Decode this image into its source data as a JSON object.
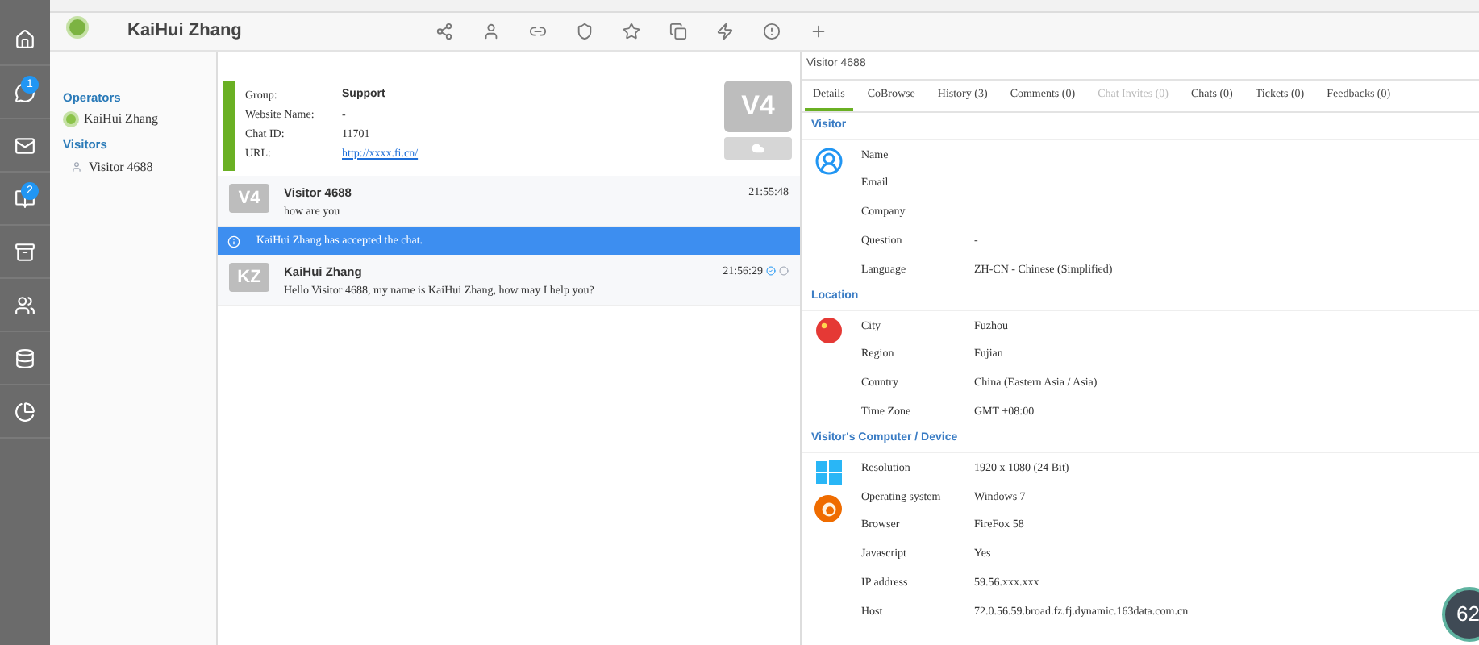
{
  "header": {
    "operator_name": "KaiHui Zhang",
    "online": true
  },
  "rail": [
    {
      "kind": "home"
    },
    {
      "kind": "chat",
      "badge": "1"
    },
    {
      "kind": "mail"
    },
    {
      "kind": "book",
      "badge": "2"
    },
    {
      "kind": "archive"
    },
    {
      "kind": "users"
    },
    {
      "kind": "database"
    },
    {
      "kind": "pie"
    }
  ],
  "sidebar": {
    "operators_title": "Operators",
    "operators": [
      {
        "name": "KaiHui Zhang",
        "online": true
      }
    ],
    "visitors_title": "Visitors",
    "visitors": [
      {
        "name": "Visitor 4688"
      }
    ]
  },
  "chat_info": {
    "rows": [
      {
        "label": "Group:",
        "value": "Support",
        "kind": "text"
      },
      {
        "label": "Website Name:",
        "value": "-",
        "kind": "text"
      },
      {
        "label": "Chat ID:",
        "value": "11701",
        "kind": "text"
      },
      {
        "label": "URL:",
        "value": "http://xxxx.fi.cn/",
        "kind": "link"
      }
    ],
    "avatar": "V4"
  },
  "messages": [
    {
      "kind": "message",
      "avatar": "V4",
      "author": "Visitor 4688",
      "text": "how are you",
      "time": "21:55:48",
      "read": false
    },
    {
      "kind": "notice",
      "text": "KaiHui Zhang has accepted the chat."
    },
    {
      "kind": "message",
      "avatar": "KZ",
      "author": "KaiHui Zhang",
      "text": "Hello Visitor 4688, my name is KaiHui Zhang, how may I help you?",
      "time": "21:56:29",
      "read": true
    }
  ],
  "visitor_panel": {
    "title": "Visitor 4688",
    "tabs": [
      {
        "label": "Details",
        "selected": true,
        "disabled": false
      },
      {
        "label": "CoBrowse",
        "selected": false,
        "disabled": false
      },
      {
        "label": "History (3)",
        "selected": false,
        "disabled": false
      },
      {
        "label": "Comments (0)",
        "selected": false,
        "disabled": false
      },
      {
        "label": "Chat Invites (0)",
        "selected": false,
        "disabled": true
      },
      {
        "label": "Chats (0)",
        "selected": false,
        "disabled": false
      },
      {
        "label": "Tickets (0)",
        "selected": false,
        "disabled": false
      },
      {
        "label": "Feedbacks (0)",
        "selected": false,
        "disabled": false
      }
    ],
    "sections": [
      {
        "title": "Visitor",
        "rows": [
          {
            "label": "Name",
            "value": ""
          },
          {
            "label": "Email",
            "value": ""
          },
          {
            "label": "Company",
            "value": ""
          },
          {
            "label": "Question",
            "value": "-"
          },
          {
            "label": "Language",
            "value": "ZH-CN - Chinese (Simplified)"
          }
        ]
      },
      {
        "title": "Location",
        "rows": [
          {
            "label": "City",
            "value": "Fuzhou"
          },
          {
            "label": "Region",
            "value": "Fujian"
          },
          {
            "label": "Country",
            "value": "China (Eastern Asia / Asia)"
          },
          {
            "label": "Time Zone",
            "value": "GMT +08:00"
          }
        ]
      },
      {
        "title": "Visitor's Computer / Device",
        "rows": [
          {
            "label": "Resolution",
            "value": "1920 x 1080 (24 Bit)"
          },
          {
            "label": "Operating system",
            "value": "Windows 7"
          },
          {
            "label": "Browser",
            "value": "FireFox 58"
          },
          {
            "label": "Javascript",
            "value": "Yes"
          },
          {
            "label": "IP address",
            "value": "59.56.xxx.xxx"
          },
          {
            "label": "Host",
            "value": "72.0.56.59.broad.fz.fj.dynamic.163data.com.cn"
          }
        ]
      }
    ]
  },
  "floating_badge": "62"
}
